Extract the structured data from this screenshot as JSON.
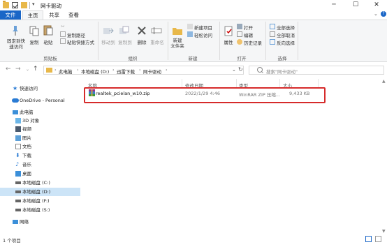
{
  "window": {
    "title": "网卡驱动",
    "min": "─",
    "max": "☐",
    "close": "✕"
  },
  "tabs": {
    "file": "文件",
    "home": "主页",
    "share": "共享",
    "view": "查看"
  },
  "ribbon": {
    "pin": "固定到快\n速访问",
    "copy": "复制",
    "paste": "粘贴",
    "copy_path": "复制路径",
    "paste_shortcut": "粘贴快捷方式",
    "cut_icon": "scissors-icon",
    "group_clipboard": "剪贴板",
    "move_to": "移动到",
    "copy_to": "复制到",
    "delete": "删除",
    "rename": "重命名",
    "group_organize": "组织",
    "new_folder": "新建\n文件夹",
    "new_item": "新建项目",
    "easy_access": "轻松访问",
    "group_new": "新建",
    "properties": "属性",
    "open": "打开",
    "edit": "编辑",
    "history": "历史记录",
    "group_open": "打开",
    "select_all": "全部选择",
    "select_none": "全部取消",
    "invert": "反向选择",
    "group_select": "选择"
  },
  "address": {
    "crumbs": [
      "此电脑",
      "本地磁盘 (D:)",
      "迅雷下载",
      "网卡驱动"
    ],
    "search_placeholder": "搜索\"网卡驱动\""
  },
  "nav": {
    "quick_access": "快速访问",
    "onedrive": "OneDrive - Personal",
    "this_pc": "此电脑",
    "objects3d": "3D 对象",
    "videos": "视频",
    "pictures": "图片",
    "documents": "文档",
    "downloads": "下载",
    "music": "音乐",
    "desktop": "桌面",
    "disk_c": "本地磁盘 (C:)",
    "disk_d": "本地磁盘 (D:)",
    "disk_f": "本地磁盘 (F:)",
    "disk_s": "本地磁盘 (S:)",
    "network": "网络"
  },
  "columns": {
    "name": "名称",
    "date": "修改日期",
    "type": "类型",
    "size": "大小"
  },
  "file": {
    "name": "realtek_pcielan_w10.zip",
    "date": "2022/1/29 4:46",
    "type": "WinRAR ZIP 压缩...",
    "size": "9,433 KB"
  },
  "status": "1 个项目",
  "colors": {
    "accent": "#1a66c7",
    "highlight": "#d62b2b",
    "folder": "#e8b84a"
  }
}
